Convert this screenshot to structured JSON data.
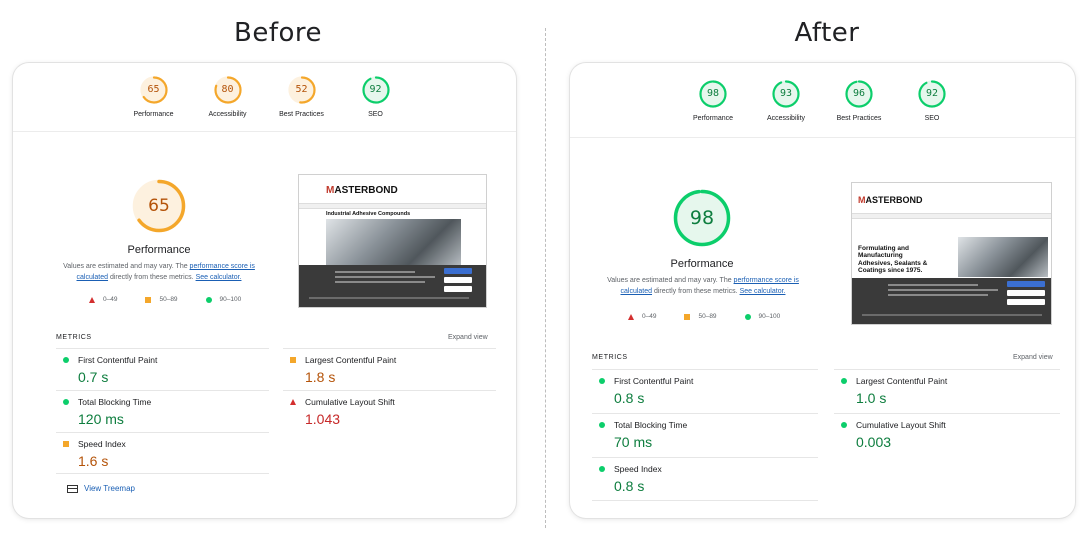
{
  "before": {
    "heading": "Before",
    "scores": [
      {
        "label": "Performance",
        "value": "65",
        "color": "#f4a72b"
      },
      {
        "label": "Accessibility",
        "value": "80",
        "color": "#f4a72b"
      },
      {
        "label": "Best Practices",
        "value": "52",
        "color": "#f4a72b"
      },
      {
        "label": "SEO",
        "value": "92",
        "color": "#0cce6b"
      }
    ],
    "performance": {
      "score": "65",
      "title": "Performance"
    },
    "note": {
      "prefix": "Values are estimated and may vary. The ",
      "link1": "performance score is calculated",
      "middle": " directly from these metrics. ",
      "link2": "See calculator."
    },
    "legend": [
      "0–49",
      "50–89",
      "90–100"
    ],
    "metrics_heading": "METRICS",
    "expand_label": "Expand view",
    "metrics": [
      {
        "label": "First Contentful Paint",
        "value": "0.7 s",
        "status": "good"
      },
      {
        "label": "Largest Contentful Paint",
        "value": "1.8 s",
        "status": "average"
      },
      {
        "label": "Total Blocking Time",
        "value": "120 ms",
        "status": "good"
      },
      {
        "label": "Cumulative Layout Shift",
        "value": "1.043",
        "status": "poor"
      },
      {
        "label": "Speed Index",
        "value": "1.6 s",
        "status": "average"
      }
    ],
    "treemap_label": "View Treemap",
    "screenshot": {
      "logo_prefix": "M",
      "logo_text": "ASTERBOND",
      "hero_text": "Industrial Adhesive Compounds"
    }
  },
  "after": {
    "heading": "After",
    "scores": [
      {
        "label": "Performance",
        "value": "98",
        "color": "#0cce6b"
      },
      {
        "label": "Accessibility",
        "value": "93",
        "color": "#0cce6b"
      },
      {
        "label": "Best Practices",
        "value": "96",
        "color": "#0cce6b"
      },
      {
        "label": "SEO",
        "value": "92",
        "color": "#0cce6b"
      }
    ],
    "performance": {
      "score": "98",
      "title": "Performance"
    },
    "note": {
      "prefix": "Values are estimated and may vary. The ",
      "link1": "performance score is calculated",
      "middle": " directly from these metrics. ",
      "link2": "See calculator."
    },
    "legend": [
      "0–49",
      "50–89",
      "90–100"
    ],
    "metrics_heading": "METRICS",
    "expand_label": "Expand view",
    "metrics": [
      {
        "label": "First Contentful Paint",
        "value": "0.8 s",
        "status": "good"
      },
      {
        "label": "Largest Contentful Paint",
        "value": "1.0 s",
        "status": "good"
      },
      {
        "label": "Total Blocking Time",
        "value": "70 ms",
        "status": "good"
      },
      {
        "label": "Cumulative Layout Shift",
        "value": "0.003",
        "status": "good"
      },
      {
        "label": "Speed Index",
        "value": "0.8 s",
        "status": "good"
      }
    ],
    "screenshot": {
      "logo_prefix": "M",
      "logo_text": "ASTERBOND",
      "hero_text": "Formulating and Manufacturing Adhesives, Sealants & Coatings since 1975."
    }
  },
  "colors": {
    "good": "#0cce6b",
    "average": "#f4a72b",
    "poor": "#d32f2f",
    "track_good": "#e6f7ed",
    "track_avg": "#fdf1df"
  }
}
